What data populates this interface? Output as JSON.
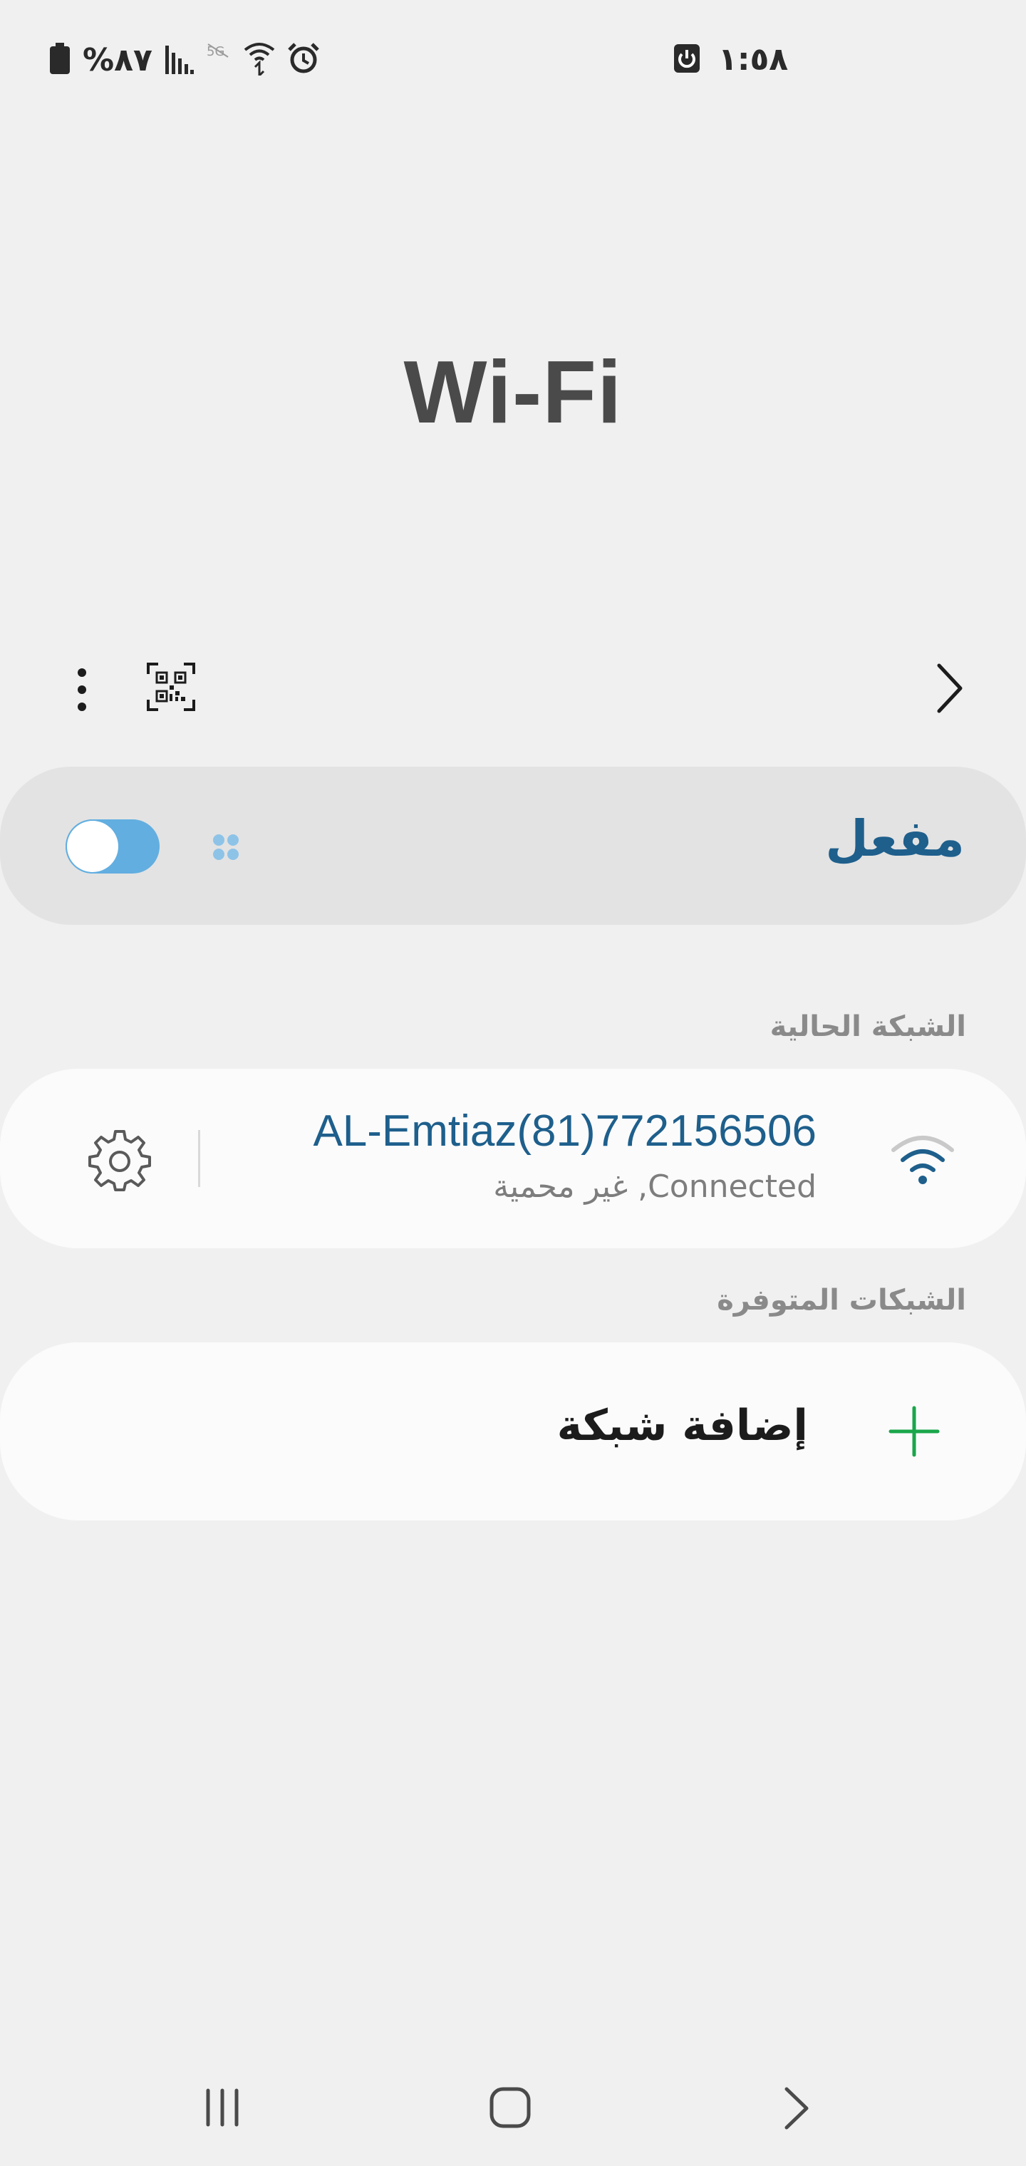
{
  "status_bar": {
    "battery_text": "%٨٧",
    "time": "١:٥٨",
    "icons": [
      "battery-icon",
      "signal-icon",
      "data-off-icon",
      "wifi-status-icon",
      "alarm-icon",
      "screen-record-icon"
    ]
  },
  "header": {
    "title": "Wi-Fi"
  },
  "toolbar": {
    "icons": [
      "more-options-icon",
      "qr-code-icon",
      "back-chevron-icon"
    ]
  },
  "wifi_toggle": {
    "label": "مفعل",
    "state": "on"
  },
  "current_network_section": {
    "header": "الشبكة الحالية",
    "network": {
      "name": "AL-Emtiaz(81)772156506",
      "status": "غير محمية ,Connected"
    }
  },
  "available_networks_section": {
    "header": "الشبكات المتوفرة",
    "add_network_label": "إضافة شبكة"
  },
  "nav_bar": {
    "buttons": [
      "recents-button",
      "home-button",
      "back-button"
    ]
  },
  "colors": {
    "accent": "#1e5f8c",
    "switch_on": "#62aee0",
    "plus": "#1aa64b",
    "background": "#f0f0f0"
  }
}
